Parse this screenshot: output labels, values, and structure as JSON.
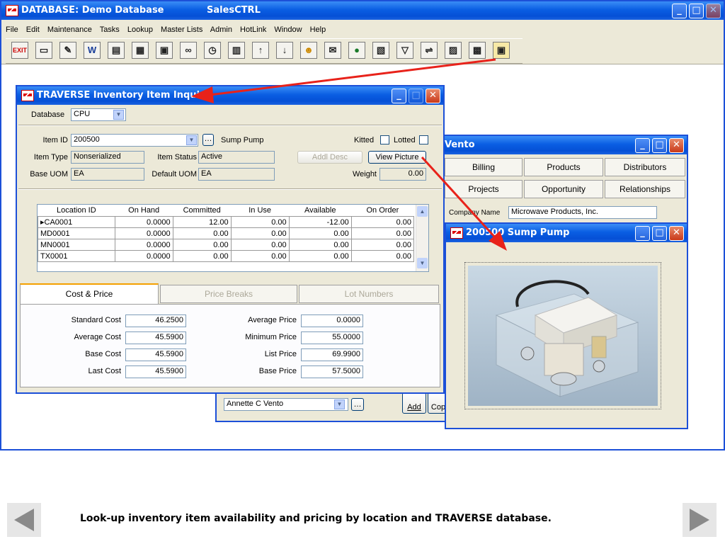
{
  "main_window": {
    "title": "DATABASE:  Demo Database",
    "app_name": "SalesCTRL",
    "menu": [
      "File",
      "Edit",
      "Maintenance",
      "Tasks",
      "Lookup",
      "Master Lists",
      "Admin",
      "HotLink",
      "Window",
      "Help"
    ],
    "toolbar": {
      "exit_label": "EXIT",
      "icons": [
        "exit-icon",
        "open-folder-icon",
        "edit-note-icon",
        "word-icon",
        "filing-cabinet-icon",
        "notepad-icon",
        "form-icon",
        "binoculars-icon",
        "clock-icon",
        "calendar-icon",
        "arrow-up-icon",
        "arrow-down-icon",
        "person-icon",
        "envelope-icon",
        "globe-icon",
        "document-icon",
        "filter-icon",
        "link-icon",
        "report-icon",
        "database-icon",
        "picture-icon"
      ]
    }
  },
  "inquiry": {
    "title": "TRAVERSE Inventory Item Inquiry",
    "database_label": "Database",
    "database_value": "CPU",
    "item_id_label": "Item ID",
    "item_id_value": "200500",
    "item_description": "Sump Pump",
    "kitted_label": "Kitted",
    "lotted_label": "Lotted",
    "item_type_label": "Item Type",
    "item_type_value": "Nonserialized",
    "item_status_label": "Item Status",
    "item_status_value": "Active",
    "addl_desc_label": "Addl Desc",
    "view_picture_label": "View Picture",
    "base_uom_label": "Base UOM",
    "base_uom_value": "EA",
    "default_uom_label": "Default UOM",
    "default_uom_value": "EA",
    "weight_label": "Weight",
    "weight_value": "0.00",
    "grid": {
      "headers": [
        "Location ID",
        "On Hand",
        "Committed",
        "In Use",
        "Available",
        "On Order"
      ],
      "rows": [
        [
          "CA0001",
          "0.0000",
          "12.00",
          "0.00",
          "-12.00",
          "0.00"
        ],
        [
          "MD0001",
          "0.0000",
          "0.00",
          "0.00",
          "0.00",
          "0.00"
        ],
        [
          "MN0001",
          "0.0000",
          "0.00",
          "0.00",
          "0.00",
          "0.00"
        ],
        [
          "TX0001",
          "0.0000",
          "0.00",
          "0.00",
          "0.00",
          "0.00"
        ]
      ]
    },
    "tabs": [
      "Cost & Price",
      "Price Breaks",
      "Lot Numbers"
    ],
    "standard_cost_label": "Standard Cost",
    "standard_cost_value": "46.2500",
    "average_cost_label": "Average Cost",
    "average_cost_value": "45.5900",
    "base_cost_label": "Base Cost",
    "base_cost_value": "45.5900",
    "last_cost_label": "Last Cost",
    "last_cost_value": "45.5900",
    "average_price_label": "Average Price",
    "average_price_value": "0.0000",
    "minimum_price_label": "Minimum Price",
    "minimum_price_value": "55.0000",
    "list_price_label": "List Price",
    "list_price_value": "69.9900",
    "base_price_label": "Base Price",
    "base_price_value": "57.5000"
  },
  "contact_window": {
    "title": "Vento",
    "tabs_row1": [
      "Billing",
      "Products",
      "Distributors"
    ],
    "tabs_row2": [
      "Projects",
      "Opportunity",
      "Relationships"
    ],
    "company_label": "Company Name",
    "company_value": "Microwave Products, Inc.",
    "rep_value": "Annette C Vento",
    "add_label": "Add",
    "copy_label": "Cop"
  },
  "picture_window": {
    "title": "200500 Sump Pump"
  },
  "caption": "Look-up inventory item availability and pricing by location and TRAVERSE database.",
  "colors": {
    "xp_blue": "#0550d6",
    "arrow_red": "#e8221a",
    "nav_gray": "#8a8a8a"
  }
}
